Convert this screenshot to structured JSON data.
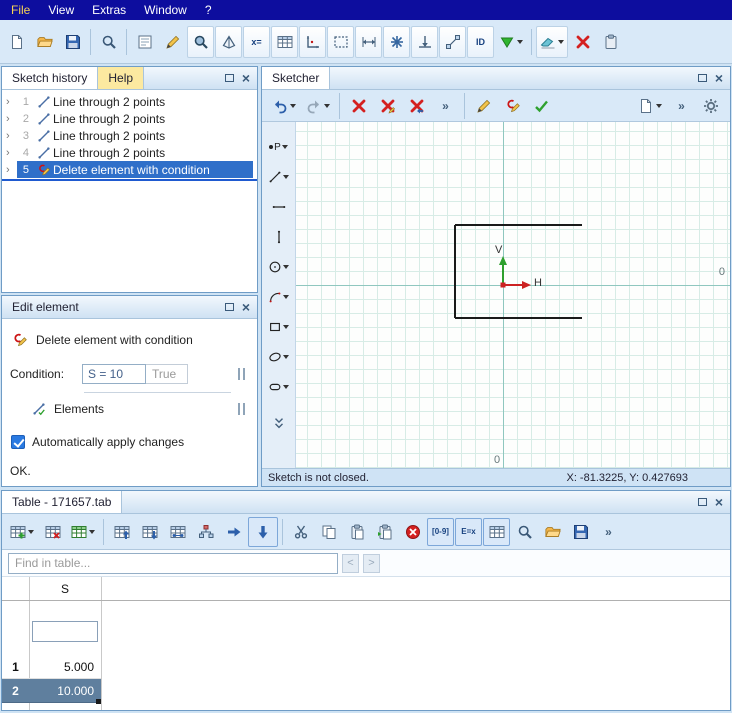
{
  "colors": {
    "menubar": "#0d0d9e",
    "selection_blue": "#2f6fc9",
    "table_selection": "#5f7f9e",
    "grid_line": "#d7ece6",
    "axis_line": "#8fc7bf",
    "status_bar": "#cfe3f5"
  },
  "glyphs": {
    "expander": "›",
    "close": "×",
    "more": "»",
    "prev": "<",
    "next": ">"
  },
  "icon_labels": {
    "point": "P",
    "x_equals": "x=",
    "id": "ID",
    "digits": "[0-9]",
    "e_equals": "E=x"
  },
  "menu": {
    "items": [
      "File",
      "View",
      "Extras",
      "Window",
      "?"
    ]
  },
  "sketch_history": {
    "tab_history": "Sketch history",
    "tab_help": "Help",
    "items": [
      {
        "num": "1",
        "label": "Line through 2 points",
        "selected": false
      },
      {
        "num": "2",
        "label": "Line through 2 points",
        "selected": false
      },
      {
        "num": "3",
        "label": "Line through 2 points",
        "selected": false
      },
      {
        "num": "4",
        "label": "Line through 2 points",
        "selected": false
      },
      {
        "num": "5",
        "label": "Delete element with condition",
        "selected": true
      }
    ]
  },
  "edit_element": {
    "title": "Edit element",
    "heading": "Delete element with condition",
    "condition_label": "Condition:",
    "condition_value": "S = 10",
    "condition_result": "True",
    "elements_label": "Elements",
    "auto_apply_label": "Automatically apply changes",
    "status": "OK."
  },
  "sketcher": {
    "title": "Sketcher",
    "axis_v_label": "V",
    "axis_h_label": "H",
    "axis_tick_bottom": "0",
    "axis_tick_right": "0",
    "status_message": "Sketch is not closed.",
    "cursor_coords": "X: -81.3225, Y: 0.427693"
  },
  "table": {
    "title": "Table - 171657.tab",
    "search_placeholder": "Find in table...",
    "column_header": "S",
    "new_value": "",
    "rows": [
      {
        "num": "1",
        "value": "5.000",
        "selected": false
      },
      {
        "num": "2",
        "value": "10.000",
        "selected": true
      }
    ]
  }
}
